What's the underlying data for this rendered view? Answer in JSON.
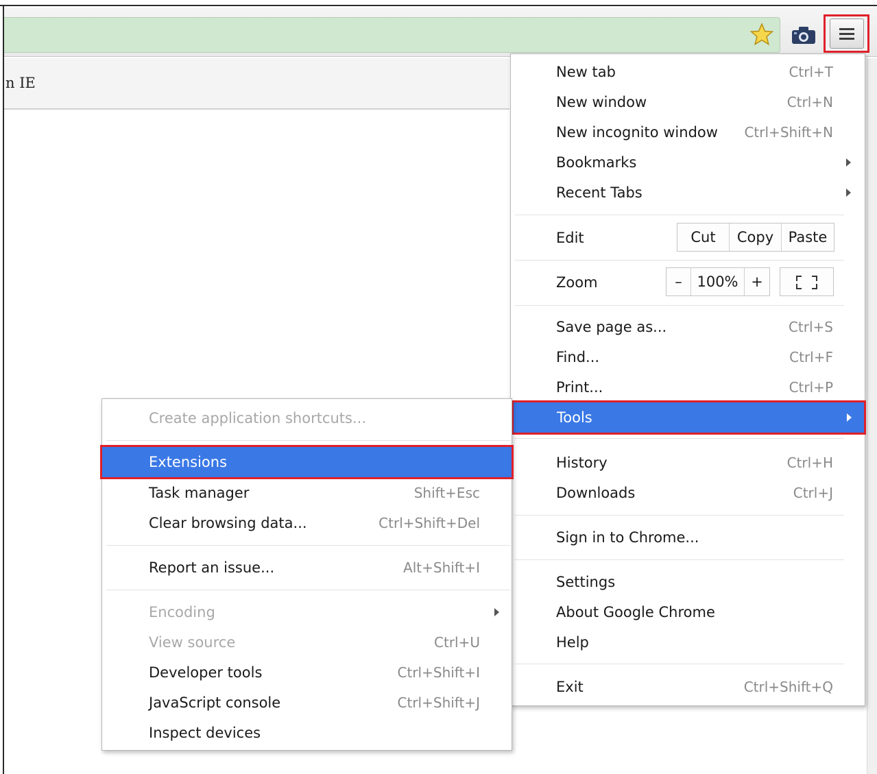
{
  "page": {
    "tab_text": "n IE"
  },
  "toolbar": {
    "star": "star-icon",
    "extension": "camera-icon",
    "menu": "hamburger-menu-icon"
  },
  "main_menu": {
    "new_tab": {
      "label": "New tab",
      "shortcut": "Ctrl+T"
    },
    "new_window": {
      "label": "New window",
      "shortcut": "Ctrl+N"
    },
    "new_incognito": {
      "label": "New incognito window",
      "shortcut": "Ctrl+Shift+N"
    },
    "bookmarks": {
      "label": "Bookmarks"
    },
    "recent_tabs": {
      "label": "Recent Tabs"
    },
    "edit": {
      "label": "Edit",
      "cut": "Cut",
      "copy": "Copy",
      "paste": "Paste"
    },
    "zoom": {
      "label": "Zoom",
      "minus": "–",
      "level": "100%",
      "plus": "+"
    },
    "save_page": {
      "label": "Save page as...",
      "shortcut": "Ctrl+S"
    },
    "find": {
      "label": "Find...",
      "shortcut": "Ctrl+F"
    },
    "print": {
      "label": "Print...",
      "shortcut": "Ctrl+P"
    },
    "tools": {
      "label": "Tools"
    },
    "history": {
      "label": "History",
      "shortcut": "Ctrl+H"
    },
    "downloads": {
      "label": "Downloads",
      "shortcut": "Ctrl+J"
    },
    "sign_in": {
      "label": "Sign in to Chrome..."
    },
    "settings": {
      "label": "Settings"
    },
    "about": {
      "label": "About Google Chrome"
    },
    "help": {
      "label": "Help"
    },
    "exit": {
      "label": "Exit",
      "shortcut": "Ctrl+Shift+Q"
    }
  },
  "tools_menu": {
    "create_shortcuts": {
      "label": "Create application shortcuts..."
    },
    "extensions": {
      "label": "Extensions"
    },
    "task_manager": {
      "label": "Task manager",
      "shortcut": "Shift+Esc"
    },
    "clear_data": {
      "label": "Clear browsing data...",
      "shortcut": "Ctrl+Shift+Del"
    },
    "report_issue": {
      "label": "Report an issue...",
      "shortcut": "Alt+Shift+I"
    },
    "encoding": {
      "label": "Encoding"
    },
    "view_source": {
      "label": "View source",
      "shortcut": "Ctrl+U"
    },
    "dev_tools": {
      "label": "Developer tools",
      "shortcut": "Ctrl+Shift+I"
    },
    "js_console": {
      "label": "JavaScript console",
      "shortcut": "Ctrl+Shift+J"
    },
    "inspect_devices": {
      "label": "Inspect devices"
    }
  },
  "colors": {
    "highlight": "#3a78e6",
    "callout": "#e0202a",
    "omnibox": "#cfe8cf"
  }
}
